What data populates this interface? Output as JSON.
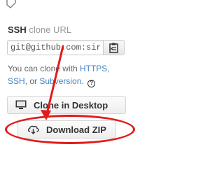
{
  "clone_url": {
    "protocol": "SSH",
    "suffix": "clone URL",
    "url_value": "git@github.com:sir"
  },
  "help": {
    "prefix": "You can clone with ",
    "https_link": "HTTPS",
    "separator": ",",
    "ssh_link": "SSH",
    "or_text": ", or ",
    "subversion_link": "Subversion",
    "end": ".",
    "help_icon_glyph": "?"
  },
  "buttons": {
    "clone_desktop": "Clone in Desktop",
    "download_zip": "Download ZIP"
  },
  "icons": {
    "clipboard": "clipboard-icon",
    "monitor": "device-desktop-icon",
    "cloud_download": "cloud-download-icon",
    "help": "question-circle-icon"
  },
  "annotation": {
    "color": "#e21b1b"
  },
  "colors": {
    "link": "#4183c4",
    "muted": "#999999",
    "text": "#333333"
  }
}
